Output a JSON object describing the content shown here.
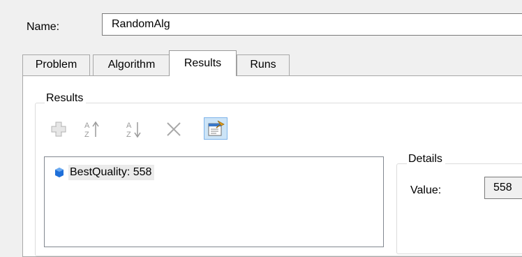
{
  "header": {
    "name_label": "Name:",
    "name_value": "RandomAlg"
  },
  "tabs": [
    {
      "label": "Problem",
      "selected": false
    },
    {
      "label": "Algorithm",
      "selected": false
    },
    {
      "label": "Results",
      "selected": true
    },
    {
      "label": "Runs",
      "selected": false
    }
  ],
  "results": {
    "group_title": "Results",
    "toolbar": [
      {
        "icon": "add-icon",
        "enabled": false
      },
      {
        "icon": "sort-ascending-icon",
        "enabled": false
      },
      {
        "icon": "sort-descending-icon",
        "enabled": false
      },
      {
        "icon": "remove-icon",
        "enabled": false
      },
      {
        "icon": "properties-icon",
        "enabled": true,
        "pressed": true
      }
    ],
    "items": [
      {
        "icon": "result-value-icon",
        "label": "BestQuality: 558"
      }
    ]
  },
  "details": {
    "group_title": "Details",
    "value_label": "Value:",
    "value": "558"
  },
  "colors": {
    "window_bg": "#f0f0f0",
    "selection_bg": "#ebebeb",
    "pressed_button_bg": "#cce4f7",
    "pressed_button_border": "#7eb4ea",
    "item_icon_blue": "#1e6fd9"
  }
}
